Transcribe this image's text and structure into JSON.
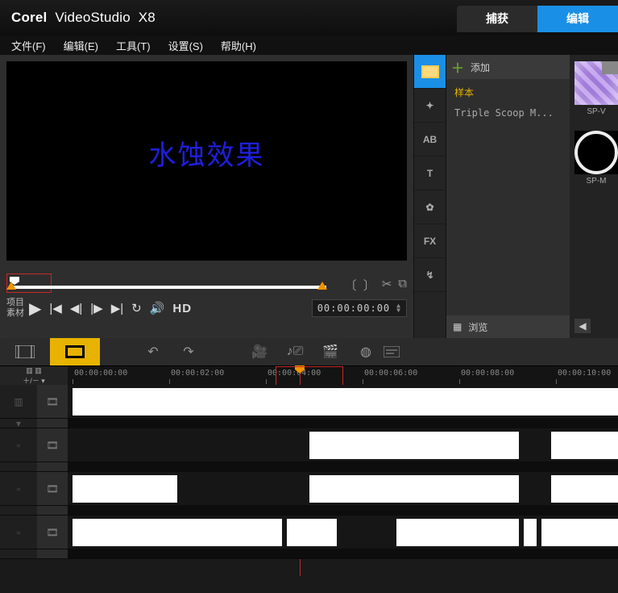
{
  "app": {
    "name_a": "Corel",
    "name_b": "VideoStudio",
    "ver": "X8"
  },
  "topTabs": {
    "capture": "捕获",
    "edit": "编辑"
  },
  "menu": {
    "file": "文件(F)",
    "edit": "编辑(E)",
    "tools": "工具(T)",
    "settings": "设置(S)",
    "help": "帮助(H)"
  },
  "preview": {
    "overlay_text": "水蚀效果",
    "labels": {
      "project": "项目",
      "clip": "素材"
    },
    "timecode": "00:00:00:00",
    "hd": "HD"
  },
  "sideTabs": {
    "media": "media",
    "fx_ed": "✦",
    "ab": "AB",
    "title": "T",
    "graphic": "✿",
    "fx": "FX",
    "path": "↯"
  },
  "library": {
    "add": "添加",
    "folder_selected": "样本",
    "folder_item": "Triple Scoop M...",
    "browse": "浏览"
  },
  "thumbs": {
    "a": "SP-V",
    "b": "SP-M"
  },
  "ruler": {
    "ticks": [
      "00:00:00:00",
      "00:00:02:00",
      "00:00:04:00",
      "00:00:06:00",
      "00:00:08:00",
      "00:00:10:00"
    ]
  },
  "tracks": {
    "glyph": "🎞"
  }
}
